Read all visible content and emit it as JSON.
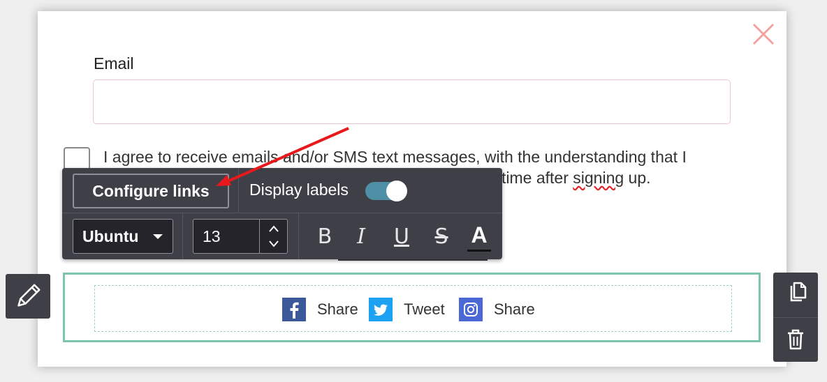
{
  "form": {
    "email_label": "Email",
    "email_value": "",
    "email_placeholder": "",
    "consent_line1": "I agree to receive emails and/or SMS text messages, with the understanding that I",
    "consent_line2_pre": "time after ",
    "consent_line2_wavy": "signing",
    "consent_line2_post": " up."
  },
  "toolbar": {
    "configure_links": "Configure links",
    "display_labels": "Display labels",
    "display_labels_on": true,
    "font": "Ubuntu",
    "font_size": "13",
    "bold": "B",
    "italic": "I",
    "underline": "U",
    "strikethrough": "S",
    "text_color": "A"
  },
  "social": {
    "items": [
      {
        "icon": "facebook-icon",
        "label": "Share",
        "color": "#3b5998"
      },
      {
        "icon": "twitter-icon",
        "label": "Tweet",
        "color": "#1da1f2"
      },
      {
        "icon": "instagram-icon",
        "label": "Share",
        "color": "#4c68d7"
      }
    ]
  },
  "icons": {
    "close": "close-icon",
    "edit": "pencil-icon",
    "duplicate": "copy-icon",
    "delete": "trash-icon"
  },
  "colors": {
    "close": "#f3a0a0",
    "toolbar_bg": "#3f3f48",
    "toggle_on": "#4f8fa5",
    "selection_border": "#7ec5b0",
    "arrow": "#e8191c"
  }
}
